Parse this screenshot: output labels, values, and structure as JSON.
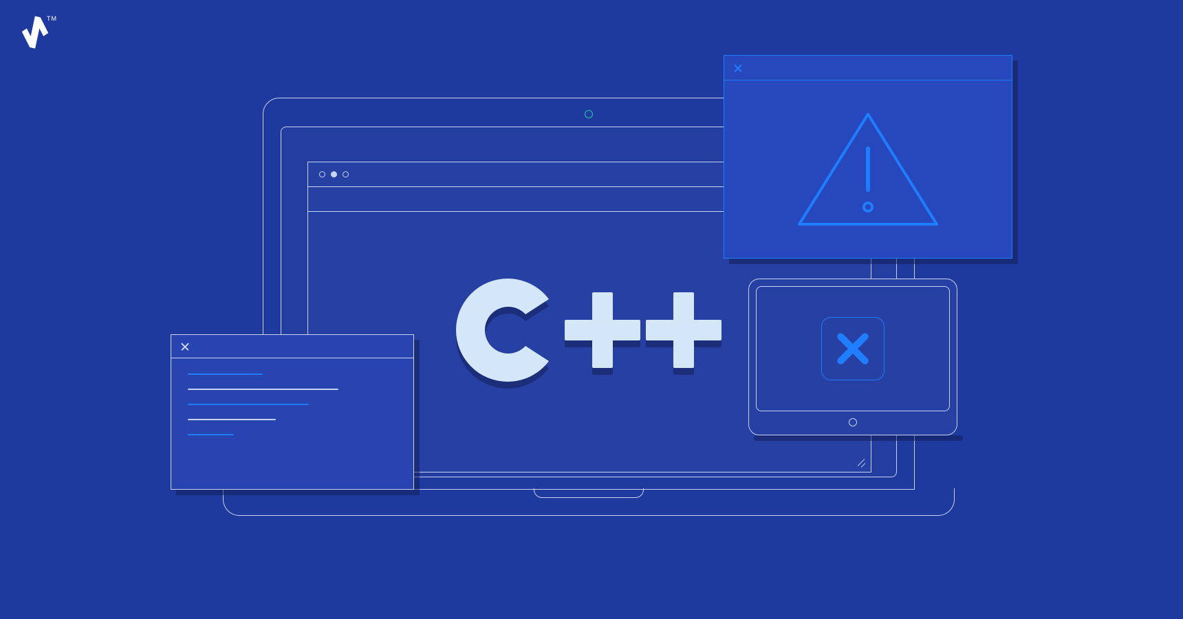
{
  "brand": {
    "logo_alt": "Toptal",
    "trademark": "TM"
  },
  "colors": {
    "background": "#1E3A9E",
    "outline": "#C8D4F0",
    "accent_bright": "#1F7DFF",
    "accent_teal": "#1FC9A8",
    "cpp_fill": "#D4E7F9"
  },
  "centerpiece": {
    "language_label": "C++"
  },
  "warning_window": {
    "icon": "warning-triangle-icon",
    "close": "×"
  },
  "tablet": {
    "icon": "error-x-icon"
  },
  "terminal": {
    "close": "×",
    "lines": [
      {
        "style": "blue",
        "width_pct": 36
      },
      {
        "style": "white",
        "width_pct": 72
      },
      {
        "style": "blue",
        "width_pct": 58
      },
      {
        "style": "white",
        "width_pct": 42
      },
      {
        "style": "blue",
        "width_pct": 22
      }
    ]
  }
}
